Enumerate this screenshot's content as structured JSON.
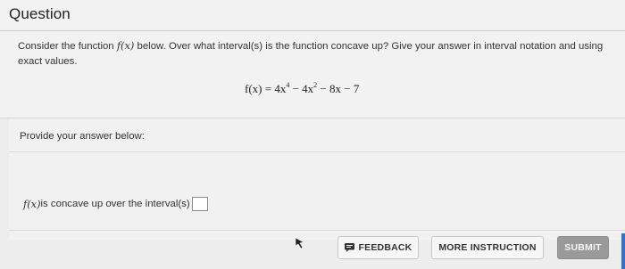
{
  "header": {
    "title": "Question"
  },
  "question": {
    "prompt_before": "Consider the function ",
    "prompt_func": "f(x)",
    "prompt_after": " below. Over what interval(s) is the function concave up? Give your answer in interval notation and using exact values."
  },
  "equation": {
    "lhs": "f(x) = 4x",
    "exp1": "4",
    "mid": " − 4x",
    "exp2": "2",
    "rhs": " − 8x − 7"
  },
  "answer": {
    "section_label": "Provide your answer below:",
    "line_func": "f(x)",
    "line_text": " is concave up over the interval(s)",
    "value": ""
  },
  "buttons": {
    "feedback": "FEEDBACK",
    "more_instruction": "MORE INSTRUCTION",
    "submit": "SUBMIT"
  },
  "colors": {
    "accent": "#2f73c8",
    "submit_bg": "#9a9a9a"
  },
  "icons": {
    "feedback": "speech-bubble-icon",
    "cursor": "mouse-pointer-icon"
  }
}
